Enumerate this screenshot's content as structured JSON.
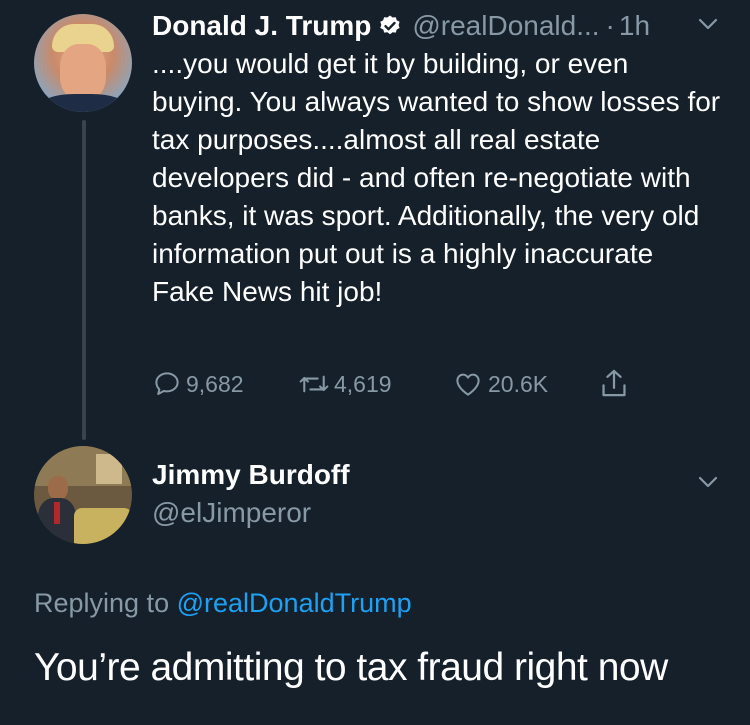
{
  "tweet": {
    "name": "Donald J. Trump",
    "handle": "@realDonald...",
    "separator": "·",
    "time": "1h",
    "text": "....you would get it by building, or even buying. You always wanted to show losses for tax purposes....almost all real estate developers did - and often re-negotiate with banks, it was sport. Additionally, the very old information put out is a highly inaccurate Fake News hit job!",
    "replies": "9,682",
    "retweets": "4,619",
    "likes": "20.6K"
  },
  "reply": {
    "name": "Jimmy Burdoff",
    "handle": "@elJimperor",
    "replying_prefix": "Replying to",
    "replying_to": "@realDonaldTrump",
    "text": "You’re admitting to tax fraud right now"
  },
  "colors": {
    "background": "#15202b",
    "secondary_text": "#8899a6",
    "accent": "#1da1f2",
    "thread_line": "#38444d"
  },
  "icons": [
    "verified-badge-icon",
    "chevron-down-icon",
    "reply-icon",
    "retweet-icon",
    "like-icon",
    "share-icon"
  ]
}
